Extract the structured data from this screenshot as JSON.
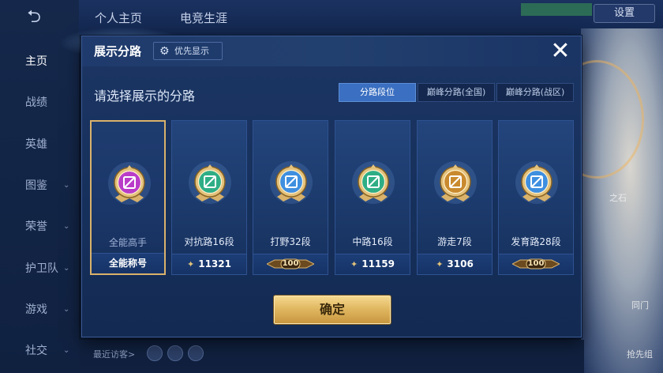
{
  "background": {
    "sidebar": [
      {
        "label": "主页",
        "active": true,
        "chevron": false
      },
      {
        "label": "战绩",
        "active": false,
        "chevron": false
      },
      {
        "label": "英雄",
        "active": false,
        "chevron": false
      },
      {
        "label": "图鉴",
        "active": false,
        "chevron": true
      },
      {
        "label": "荣誉",
        "active": false,
        "chevron": true
      },
      {
        "label": "护卫队",
        "active": false,
        "chevron": true
      },
      {
        "label": "游戏",
        "active": false,
        "chevron": true
      },
      {
        "label": "社交",
        "active": false,
        "chevron": true
      }
    ],
    "top_tabs": [
      "个人主页",
      "电竞生涯"
    ],
    "settings_label": "设置",
    "recent_visitors_label": "最近访客>",
    "right_texts": [
      "之石",
      "同门",
      "抢先组"
    ]
  },
  "modal": {
    "title": "展示分路",
    "priority_button_label": "优先显示",
    "close_icon": "close-icon",
    "subtitle": "请选择展示的分路",
    "segments": [
      {
        "label": "分路段位",
        "active": true
      },
      {
        "label": "巅峰分路(全国)",
        "active": false
      },
      {
        "label": "巅峰分路(战区)",
        "active": false
      }
    ],
    "cards": [
      {
        "rank_label": "全能高手",
        "footer_type": "title",
        "footer_text": "全能称号",
        "selected": true,
        "emblem_color": "#b93cc9",
        "emblem_icon": "all-round-icon"
      },
      {
        "rank_label": "对抗路16段",
        "footer_type": "score",
        "footer_text": "11321",
        "selected": false,
        "emblem_color": "#2fae86",
        "emblem_icon": "clash-lane-icon"
      },
      {
        "rank_label": "打野32段",
        "footer_type": "badge",
        "footer_text": "100",
        "selected": false,
        "emblem_color": "#3f8fe0",
        "emblem_icon": "jungle-icon"
      },
      {
        "rank_label": "中路16段",
        "footer_type": "score",
        "footer_text": "11159",
        "selected": false,
        "emblem_color": "#2fae86",
        "emblem_icon": "mid-lane-icon"
      },
      {
        "rank_label": "游走7段",
        "footer_type": "score",
        "footer_text": "3106",
        "selected": false,
        "emblem_color": "#c98a2f",
        "emblem_icon": "roam-icon"
      },
      {
        "rank_label": "发育路28段",
        "footer_type": "badge",
        "footer_text": "100",
        "selected": false,
        "emblem_color": "#3f8fe0",
        "emblem_icon": "farm-lane-icon"
      }
    ],
    "confirm_label": "确定"
  }
}
